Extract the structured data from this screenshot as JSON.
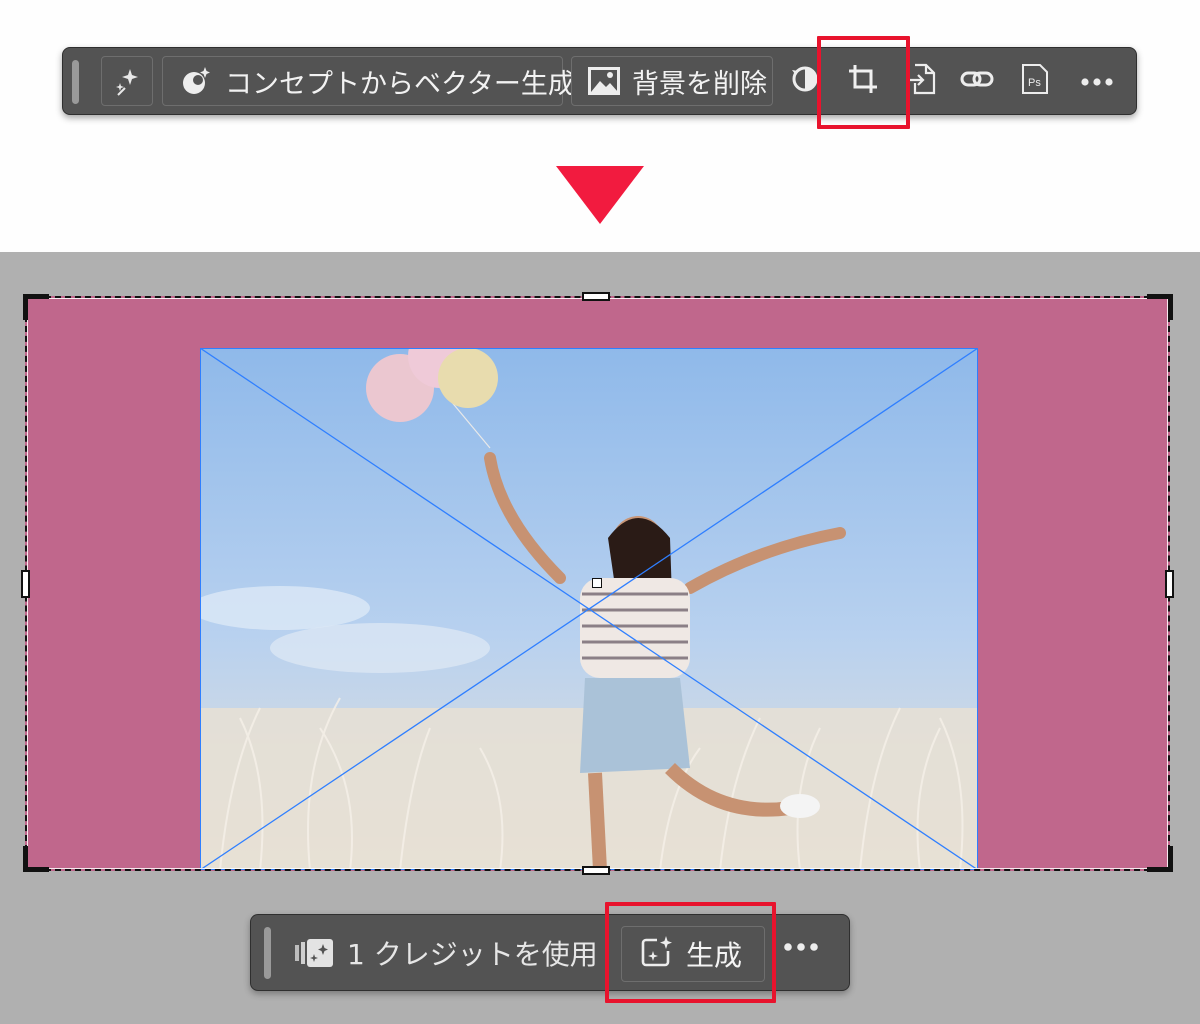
{
  "taskbar": {
    "concept_label": "コンセプトからベクター生成",
    "remove_bg_label": "背景を削除",
    "icons": [
      "magic-wand-icon",
      "concept-sparkle-icon",
      "image-icon",
      "recolor-icon",
      "crop-icon",
      "export-icon",
      "link-icon",
      "photoshop-icon",
      "more-icon"
    ]
  },
  "generate_bar": {
    "credit_text": "1 クレジットを使用",
    "generate_label": "生成",
    "icons": [
      "credits-icon",
      "generate-sparkle-icon",
      "more-icon"
    ]
  },
  "colors": {
    "highlight": "#e8132d",
    "arrow": "#f21b3f",
    "artboard": "#c0678c",
    "toolbar": "#535353",
    "canvas_bg": "#b0b0b0",
    "diagonal": "#2f7fff"
  }
}
